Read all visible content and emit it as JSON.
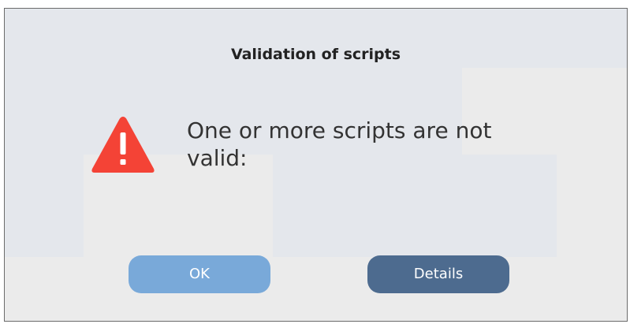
{
  "dialog": {
    "title": "Validation of scripts",
    "icon": "warning-triangle-icon",
    "message": "One or more scripts are not valid:",
    "buttons": {
      "ok_label": "OK",
      "details_label": "Details"
    }
  },
  "colors": {
    "warning_red": "#f44336",
    "ok_button": "#79a9d9",
    "details_button": "#4d6b8f"
  }
}
